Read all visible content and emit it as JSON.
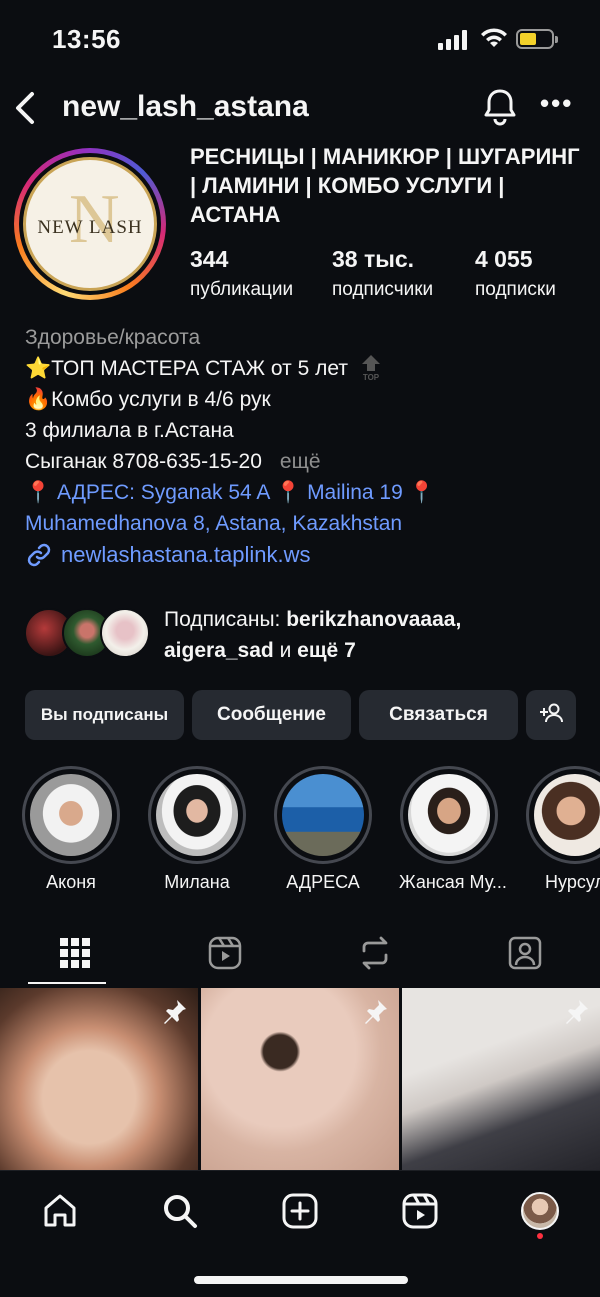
{
  "status_bar": {
    "time": "13:56"
  },
  "header": {
    "username": "new_lash_astana"
  },
  "profile": {
    "logo_text": "NEW LASH",
    "logo_letter": "N",
    "title": "РЕСНИЦЫ | МАНИКЮР | ШУГАРИНГ | ЛАМИНИ | КОМБО УСЛУГИ | АСТАНА",
    "stats": [
      {
        "value": "344",
        "label": "публикации"
      },
      {
        "value": "38 тыс.",
        "label": "подписчики"
      },
      {
        "value": "4 055",
        "label": "подписки"
      }
    ],
    "category": "Здоровье/красота",
    "bio_lines": [
      "⭐ТОП МАСТЕРА СТАЖ от 5 лет",
      "🔥Комбо услуги в 4/6 рук",
      "3 филиала в г.Астана",
      "Сыганак 8708-635-15-20"
    ],
    "bio_more": "ещё",
    "address_line1": "АДРЕС: Syganak 54 A",
    "address_part2": "Mailina 19",
    "address_line2": "Muhamedhanova 8, Astana, Kazakhstan",
    "link": "newlashastana.taplink.ws"
  },
  "followed_by": {
    "prefix": "Подписаны: ",
    "user1": "berikzhanovaaaa,",
    "user2": "aigera_sad",
    "suffix_and": " и ",
    "suffix_more": "ещё 7"
  },
  "buttons": {
    "following": "Вы подписаны",
    "message": "Сообщение",
    "contact": "Связаться"
  },
  "highlights": [
    {
      "label": "Аконя"
    },
    {
      "label": "Милана"
    },
    {
      "label": "АДРЕСА"
    },
    {
      "label": "Жансая Му..."
    },
    {
      "label": "Нурсул"
    }
  ],
  "colors": {
    "background": "#0b0d11",
    "button": "#262a31",
    "link": "#6f9bff",
    "notification_dot": "#ff3040"
  }
}
